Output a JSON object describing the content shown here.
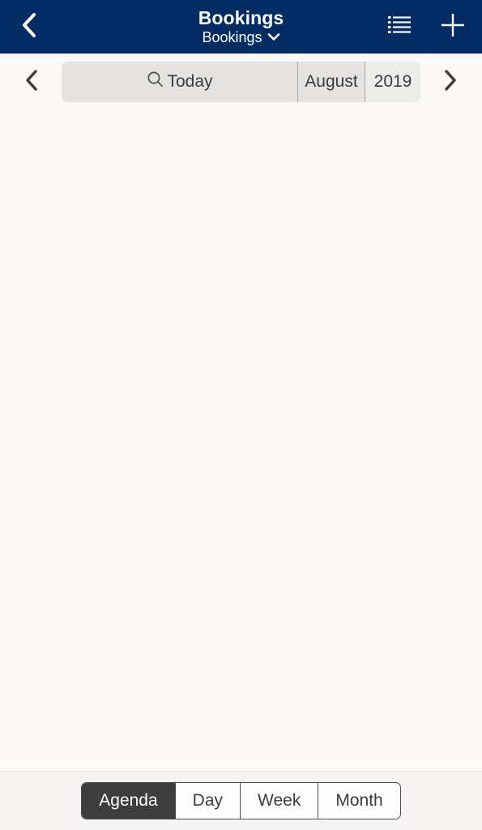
{
  "header": {
    "back_icon": "chevron-left-icon",
    "title": "Bookings",
    "subtitle": "Bookings",
    "subtitle_caret": "⌄",
    "list_icon": "bulleted-list-icon",
    "add_icon": "plus-icon",
    "background_color": "#042c64",
    "text_color": "#ffffff"
  },
  "date_toolbar": {
    "prev_icon": "chevron-left-icon",
    "next_icon": "chevron-right-icon",
    "search_icon": "search-icon",
    "today_label": "Today",
    "month_label": "August",
    "year_label": "2019",
    "pill_color": "#e4e3e1",
    "year_cell_color": "#ececea"
  },
  "content": {
    "background_color": "#faf9f7",
    "items": []
  },
  "view_switcher": {
    "selected": "Agenda",
    "segments": [
      {
        "label": "Agenda"
      },
      {
        "label": "Day"
      },
      {
        "label": "Week"
      },
      {
        "label": "Month"
      }
    ],
    "selected_color": "#3e3e3e"
  }
}
